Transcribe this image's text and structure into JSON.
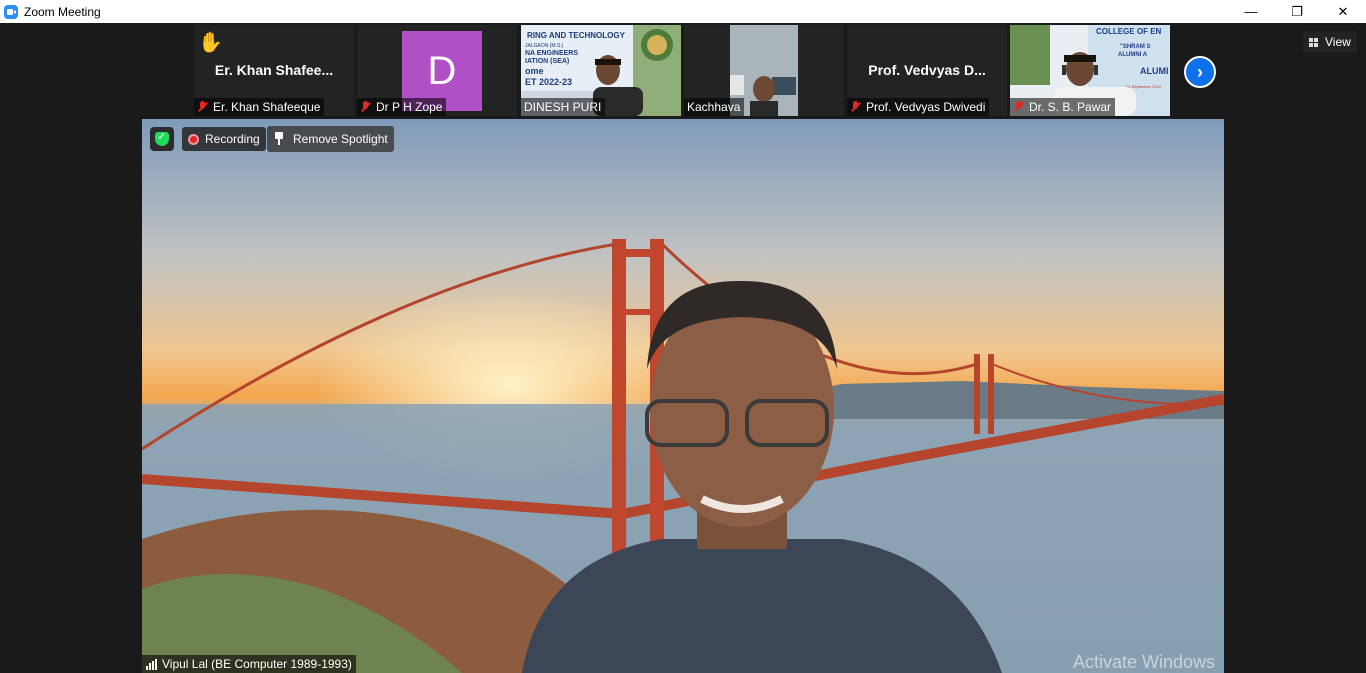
{
  "window": {
    "title": "Zoom Meeting",
    "minimize": "—",
    "restore": "❐",
    "close": "✕"
  },
  "gallery": {
    "tiles": [
      {
        "big_name": "Er. Khan Shafee...",
        "name": "Er. Khan Shafeeque",
        "muted": true,
        "raised_hand": true
      },
      {
        "avatar_letter": "D",
        "name": "Dr P H Zope",
        "muted": true
      },
      {
        "name": "DINESH PURI",
        "muted": false,
        "video": true
      },
      {
        "name": "Kachhava",
        "muted": false,
        "video": true
      },
      {
        "big_name": "Prof. Vedvyas D...",
        "name": "Prof. Vedvyas Dwivedi",
        "muted": true
      },
      {
        "name": "Dr. S. B. Pawar",
        "muted": true,
        "video": true
      }
    ],
    "banner_text": {
      "dinesh": [
        "RING AND TECHNOLOGY",
        "JALGAON (M.S.)",
        "NA ENGINEERS",
        "IATION (SEA)",
        "ome",
        "ET 2022-23"
      ],
      "pawar": [
        "COLLEGE OF EN",
        "\"SHRAM S",
        "ALUMNI A",
        "ALUMI",
        "24 September 2022"
      ]
    },
    "next_arrow": "›",
    "view_label": "View"
  },
  "main": {
    "recording_label": "Recording",
    "spotlight_label": "Remove Spotlight",
    "speaker_name": "Vipul Lal (BE Computer 1989-1993)"
  },
  "watermark": "Activate Windows",
  "colors": {
    "zoom_blue": "#0e71eb",
    "muted_red": "#e02828",
    "avatar_purple": "#b04fc6",
    "secure_green": "#23d959"
  }
}
